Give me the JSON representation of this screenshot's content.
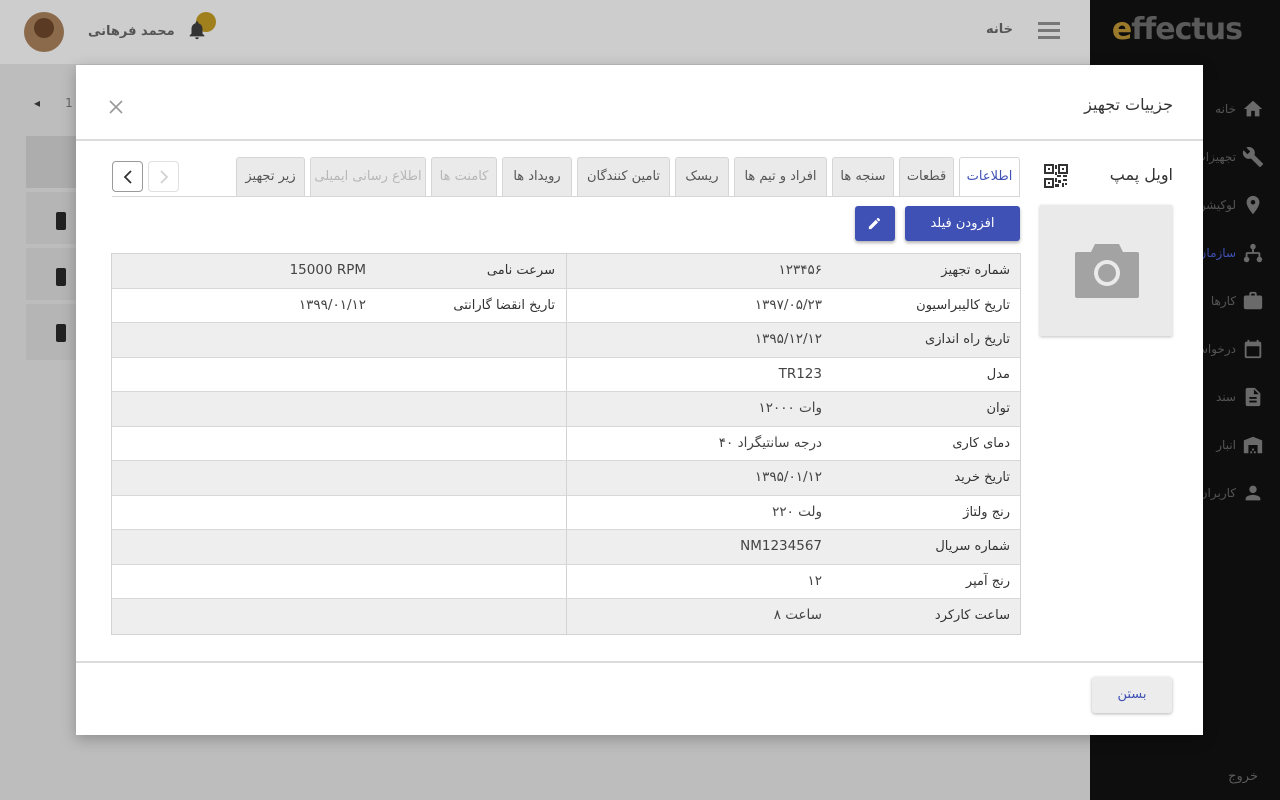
{
  "app": {
    "brand": "Effectus",
    "header": {
      "home_label": "خانه",
      "user_name": "محمد فرهانی"
    },
    "sidebar": {
      "items": [
        {
          "label": "خانه",
          "icon": "home-icon"
        },
        {
          "label": "تجهیزات",
          "icon": "wrench-icon"
        },
        {
          "label": "لوکیشن",
          "icon": "location-pin-icon"
        },
        {
          "label": "سازمان",
          "icon": "hierarchy-icon"
        },
        {
          "label": "کارها",
          "icon": "work-icon"
        },
        {
          "label": "درخواست",
          "icon": "calendar-icon"
        },
        {
          "label": "سند",
          "icon": "document-icon"
        },
        {
          "label": "انبار",
          "icon": "warehouse-icon"
        },
        {
          "label": "کاربران",
          "icon": "user-icon"
        }
      ],
      "logout_label": "خروج"
    },
    "pager": {
      "prev": "◂",
      "page": "1"
    }
  },
  "modal": {
    "title": "جزییات تجهیز",
    "equipment_name": "اویل پمپ",
    "tabs": [
      {
        "label": "اطلاعات",
        "state": "active"
      },
      {
        "label": "قطعات",
        "state": "normal"
      },
      {
        "label": "سنجه ها",
        "state": "normal"
      },
      {
        "label": "افراد و تیم ها",
        "state": "normal"
      },
      {
        "label": "ریسک",
        "state": "normal"
      },
      {
        "label": "تامین کنندگان",
        "state": "normal"
      },
      {
        "label": "رویداد ها",
        "state": "normal"
      },
      {
        "label": "کامنت ها",
        "state": "disabled"
      },
      {
        "label": "اطلاع رسانی ایمیلی",
        "state": "disabled"
      },
      {
        "label": "زیر تجهیز",
        "state": "normal"
      }
    ],
    "add_field_label": "افزودن فیلد",
    "close_label": "بستن",
    "rows": [
      {
        "label": "شماره تجهیز",
        "value": "۱۲۳۴۵۶",
        "label2": "سرعت نامی",
        "value2": "15000 RPM"
      },
      {
        "label": "تاریخ کالیبراسیون",
        "value": "۱۳۹۷/۰۵/۲۳",
        "label2": "تاریخ انقضا گارانتی",
        "value2": "۱۳۹۹/۰۱/۱۲"
      },
      {
        "label": "تاریخ راه اندازی",
        "value": "۱۳۹۵/۱۲/۱۲",
        "label2": "",
        "value2": ""
      },
      {
        "label": "مدل",
        "value": "TR123",
        "label2": "",
        "value2": ""
      },
      {
        "label": "توان",
        "value": "۱۲۰۰۰ وات",
        "label2": "",
        "value2": ""
      },
      {
        "label": "دمای کاری",
        "value": "۴۰ درجه سانتیگراد",
        "label2": "",
        "value2": ""
      },
      {
        "label": "تاریخ خرید",
        "value": "۱۳۹۵/۰۱/۱۲",
        "label2": "",
        "value2": ""
      },
      {
        "label": "رنج ولتاژ",
        "value": "۲۲۰ ولت",
        "label2": "",
        "value2": ""
      },
      {
        "label": "شماره سریال",
        "value": "NM1234567",
        "label2": "",
        "value2": ""
      },
      {
        "label": "رنج آمپر",
        "value": "۱۲",
        "label2": "",
        "value2": ""
      },
      {
        "label": "ساعت کارکرد",
        "value": "۸ ساعت",
        "label2": "",
        "value2": ""
      }
    ]
  },
  "colors": {
    "primary": "#3f51b5",
    "overlay": "#c4c4c4",
    "sidebar": "#0e0e0e"
  }
}
